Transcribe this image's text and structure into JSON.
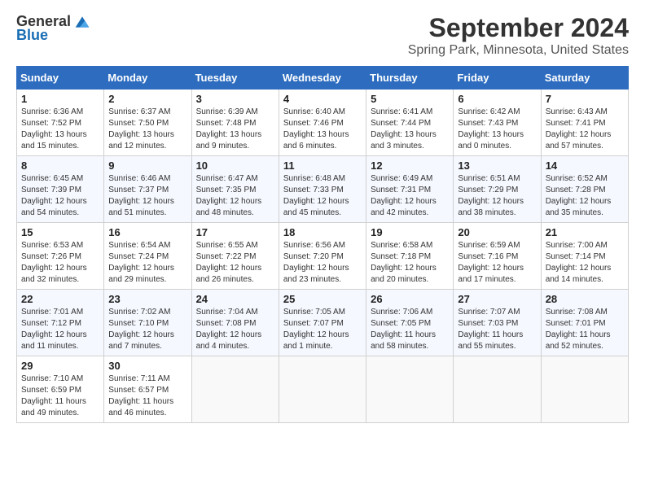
{
  "header": {
    "logo_general": "General",
    "logo_blue": "Blue",
    "month": "September 2024",
    "location": "Spring Park, Minnesota, United States"
  },
  "days_of_week": [
    "Sunday",
    "Monday",
    "Tuesday",
    "Wednesday",
    "Thursday",
    "Friday",
    "Saturday"
  ],
  "weeks": [
    [
      {
        "day": "1",
        "sunrise": "6:36 AM",
        "sunset": "7:52 PM",
        "daylight": "13 hours and 15 minutes."
      },
      {
        "day": "2",
        "sunrise": "6:37 AM",
        "sunset": "7:50 PM",
        "daylight": "13 hours and 12 minutes."
      },
      {
        "day": "3",
        "sunrise": "6:39 AM",
        "sunset": "7:48 PM",
        "daylight": "13 hours and 9 minutes."
      },
      {
        "day": "4",
        "sunrise": "6:40 AM",
        "sunset": "7:46 PM",
        "daylight": "13 hours and 6 minutes."
      },
      {
        "day": "5",
        "sunrise": "6:41 AM",
        "sunset": "7:44 PM",
        "daylight": "13 hours and 3 minutes."
      },
      {
        "day": "6",
        "sunrise": "6:42 AM",
        "sunset": "7:43 PM",
        "daylight": "13 hours and 0 minutes."
      },
      {
        "day": "7",
        "sunrise": "6:43 AM",
        "sunset": "7:41 PM",
        "daylight": "12 hours and 57 minutes."
      }
    ],
    [
      {
        "day": "8",
        "sunrise": "6:45 AM",
        "sunset": "7:39 PM",
        "daylight": "12 hours and 54 minutes."
      },
      {
        "day": "9",
        "sunrise": "6:46 AM",
        "sunset": "7:37 PM",
        "daylight": "12 hours and 51 minutes."
      },
      {
        "day": "10",
        "sunrise": "6:47 AM",
        "sunset": "7:35 PM",
        "daylight": "12 hours and 48 minutes."
      },
      {
        "day": "11",
        "sunrise": "6:48 AM",
        "sunset": "7:33 PM",
        "daylight": "12 hours and 45 minutes."
      },
      {
        "day": "12",
        "sunrise": "6:49 AM",
        "sunset": "7:31 PM",
        "daylight": "12 hours and 42 minutes."
      },
      {
        "day": "13",
        "sunrise": "6:51 AM",
        "sunset": "7:29 PM",
        "daylight": "12 hours and 38 minutes."
      },
      {
        "day": "14",
        "sunrise": "6:52 AM",
        "sunset": "7:28 PM",
        "daylight": "12 hours and 35 minutes."
      }
    ],
    [
      {
        "day": "15",
        "sunrise": "6:53 AM",
        "sunset": "7:26 PM",
        "daylight": "12 hours and 32 minutes."
      },
      {
        "day": "16",
        "sunrise": "6:54 AM",
        "sunset": "7:24 PM",
        "daylight": "12 hours and 29 minutes."
      },
      {
        "day": "17",
        "sunrise": "6:55 AM",
        "sunset": "7:22 PM",
        "daylight": "12 hours and 26 minutes."
      },
      {
        "day": "18",
        "sunrise": "6:56 AM",
        "sunset": "7:20 PM",
        "daylight": "12 hours and 23 minutes."
      },
      {
        "day": "19",
        "sunrise": "6:58 AM",
        "sunset": "7:18 PM",
        "daylight": "12 hours and 20 minutes."
      },
      {
        "day": "20",
        "sunrise": "6:59 AM",
        "sunset": "7:16 PM",
        "daylight": "12 hours and 17 minutes."
      },
      {
        "day": "21",
        "sunrise": "7:00 AM",
        "sunset": "7:14 PM",
        "daylight": "12 hours and 14 minutes."
      }
    ],
    [
      {
        "day": "22",
        "sunrise": "7:01 AM",
        "sunset": "7:12 PM",
        "daylight": "12 hours and 11 minutes."
      },
      {
        "day": "23",
        "sunrise": "7:02 AM",
        "sunset": "7:10 PM",
        "daylight": "12 hours and 7 minutes."
      },
      {
        "day": "24",
        "sunrise": "7:04 AM",
        "sunset": "7:08 PM",
        "daylight": "12 hours and 4 minutes."
      },
      {
        "day": "25",
        "sunrise": "7:05 AM",
        "sunset": "7:07 PM",
        "daylight": "12 hours and 1 minute."
      },
      {
        "day": "26",
        "sunrise": "7:06 AM",
        "sunset": "7:05 PM",
        "daylight": "11 hours and 58 minutes."
      },
      {
        "day": "27",
        "sunrise": "7:07 AM",
        "sunset": "7:03 PM",
        "daylight": "11 hours and 55 minutes."
      },
      {
        "day": "28",
        "sunrise": "7:08 AM",
        "sunset": "7:01 PM",
        "daylight": "11 hours and 52 minutes."
      }
    ],
    [
      {
        "day": "29",
        "sunrise": "7:10 AM",
        "sunset": "6:59 PM",
        "daylight": "11 hours and 49 minutes."
      },
      {
        "day": "30",
        "sunrise": "7:11 AM",
        "sunset": "6:57 PM",
        "daylight": "11 hours and 46 minutes."
      },
      null,
      null,
      null,
      null,
      null
    ]
  ]
}
